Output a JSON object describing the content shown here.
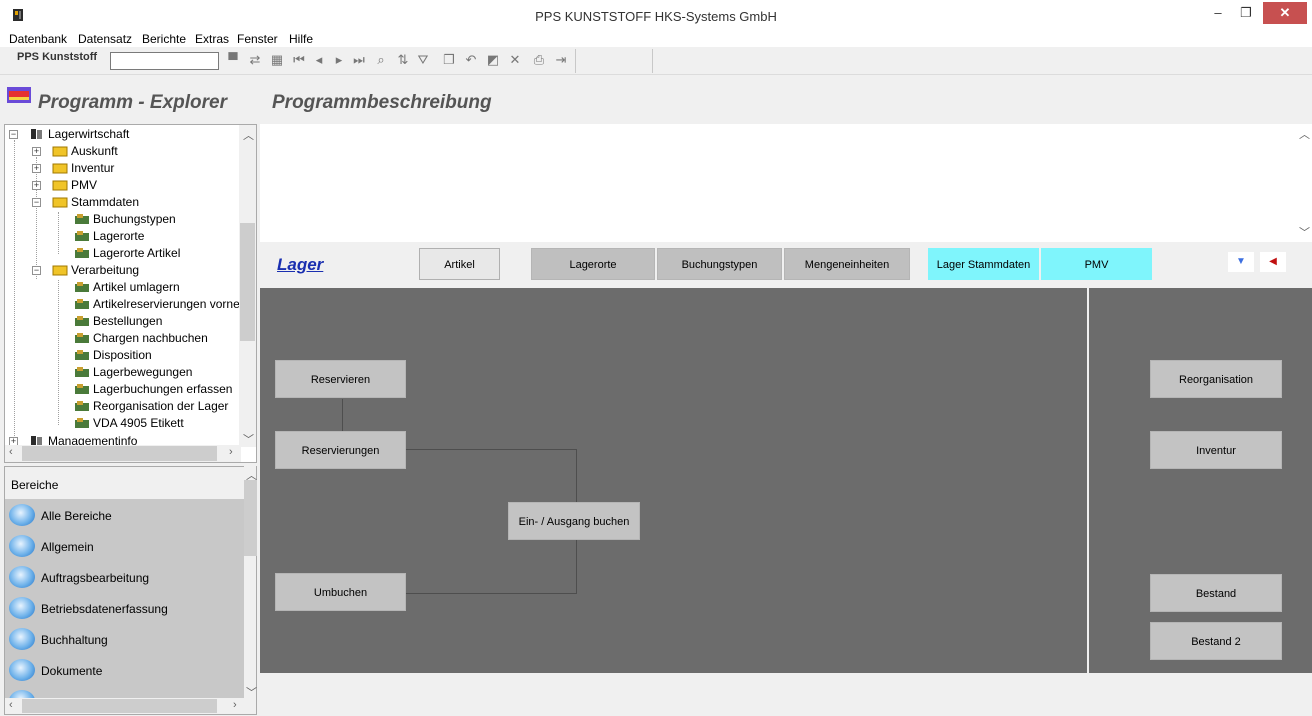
{
  "window": {
    "title": "PPS KUNSTSTOFF HKS-Systems GmbH",
    "min": "–",
    "max": "❐",
    "close": "✕"
  },
  "menu": [
    "Datenbank",
    "Datensatz",
    "Berichte",
    "Extras",
    "Fenster",
    "Hilfe"
  ],
  "toolbar": {
    "label": "PPS Kunststoff",
    "input_value": "",
    "icons": [
      "new-record-icon",
      "refresh-icon",
      "grid-icon",
      "first-record-icon",
      "previous-record-icon",
      "next-record-icon",
      "last-record-icon",
      "search-record-icon",
      "sort-icon",
      "filter-icon",
      "copy-icon",
      "undo-icon",
      "save-icon",
      "delete-icon",
      "print-icon",
      "exit-icon"
    ]
  },
  "headers": {
    "explorer": "Programm - Explorer",
    "description": "Programmbeschreibung"
  },
  "tree": [
    {
      "label": "Lagerwirtschaft",
      "level": 0,
      "expander": "−",
      "icon": "books-icon"
    },
    {
      "label": "Auskunft",
      "level": 1,
      "expander": "+",
      "icon": "folder-icon"
    },
    {
      "label": "Inventur",
      "level": 1,
      "expander": "+",
      "icon": "folder-icon"
    },
    {
      "label": "PMV",
      "level": 1,
      "expander": "+",
      "icon": "folder-icon"
    },
    {
      "label": "Stammdaten",
      "level": 1,
      "expander": "−",
      "icon": "folder-icon"
    },
    {
      "label": "Buchungstypen",
      "level": 2,
      "expander": "",
      "icon": "program-icon"
    },
    {
      "label": "Lagerorte",
      "level": 2,
      "expander": "",
      "icon": "program-icon"
    },
    {
      "label": "Lagerorte Artikel",
      "level": 2,
      "expander": "",
      "icon": "program-icon"
    },
    {
      "label": "Verarbeitung",
      "level": 1,
      "expander": "−",
      "icon": "folder-icon"
    },
    {
      "label": "Artikel umlagern",
      "level": 2,
      "expander": "",
      "icon": "program-icon"
    },
    {
      "label": "Artikelreservierungen vornel",
      "level": 2,
      "expander": "",
      "icon": "program-icon"
    },
    {
      "label": "Bestellungen",
      "level": 2,
      "expander": "",
      "icon": "program-icon"
    },
    {
      "label": "Chargen nachbuchen",
      "level": 2,
      "expander": "",
      "icon": "program-icon"
    },
    {
      "label": "Disposition",
      "level": 2,
      "expander": "",
      "icon": "program-icon"
    },
    {
      "label": "Lagerbewegungen",
      "level": 2,
      "expander": "",
      "icon": "program-icon"
    },
    {
      "label": "Lagerbuchungen erfassen",
      "level": 2,
      "expander": "",
      "icon": "program-icon"
    },
    {
      "label": "Reorganisation der Lager",
      "level": 2,
      "expander": "",
      "icon": "program-icon"
    },
    {
      "label": "VDA 4905 Etikett",
      "level": 2,
      "expander": "",
      "icon": "program-icon"
    },
    {
      "label": "Managementinfo",
      "level": 0,
      "expander": "+",
      "icon": "books-icon"
    }
  ],
  "bereiche": {
    "title": "Bereiche",
    "items": [
      "Alle Bereiche",
      "Allgemein",
      "Auftragsbearbeitung",
      "Betriebsdatenerfassung",
      "Buchhaltung",
      "Dokumente",
      ""
    ]
  },
  "tabs": {
    "title": "Lager",
    "items": [
      {
        "label": "Artikel",
        "style": "active"
      },
      {
        "label": "Lagerorte",
        "style": "gray"
      },
      {
        "label": "Buchungstypen",
        "style": "gray"
      },
      {
        "label": "Mengeneinheiten",
        "style": "gray"
      },
      {
        "label": "Lager  Stammdaten",
        "style": "cyan"
      },
      {
        "label": "PMV",
        "style": "cyan"
      }
    ],
    "nav_down": "▼",
    "nav_left": "◀"
  },
  "workflow": {
    "reservieren": "Reservieren",
    "reservierungen": "Reservierungen",
    "buchen": "Ein- / Ausgang buchen",
    "umbuchen": "Umbuchen",
    "reorganisation": "Reorganisation",
    "inventur": "Inventur",
    "bestand": "Bestand",
    "bestand2": "Bestand 2"
  },
  "colors": {
    "workflow_bg": "#6c6c6c",
    "cyan_tab": "#7ff5fc",
    "link_blue": "#1a2fb0",
    "close_red": "#c75050"
  }
}
